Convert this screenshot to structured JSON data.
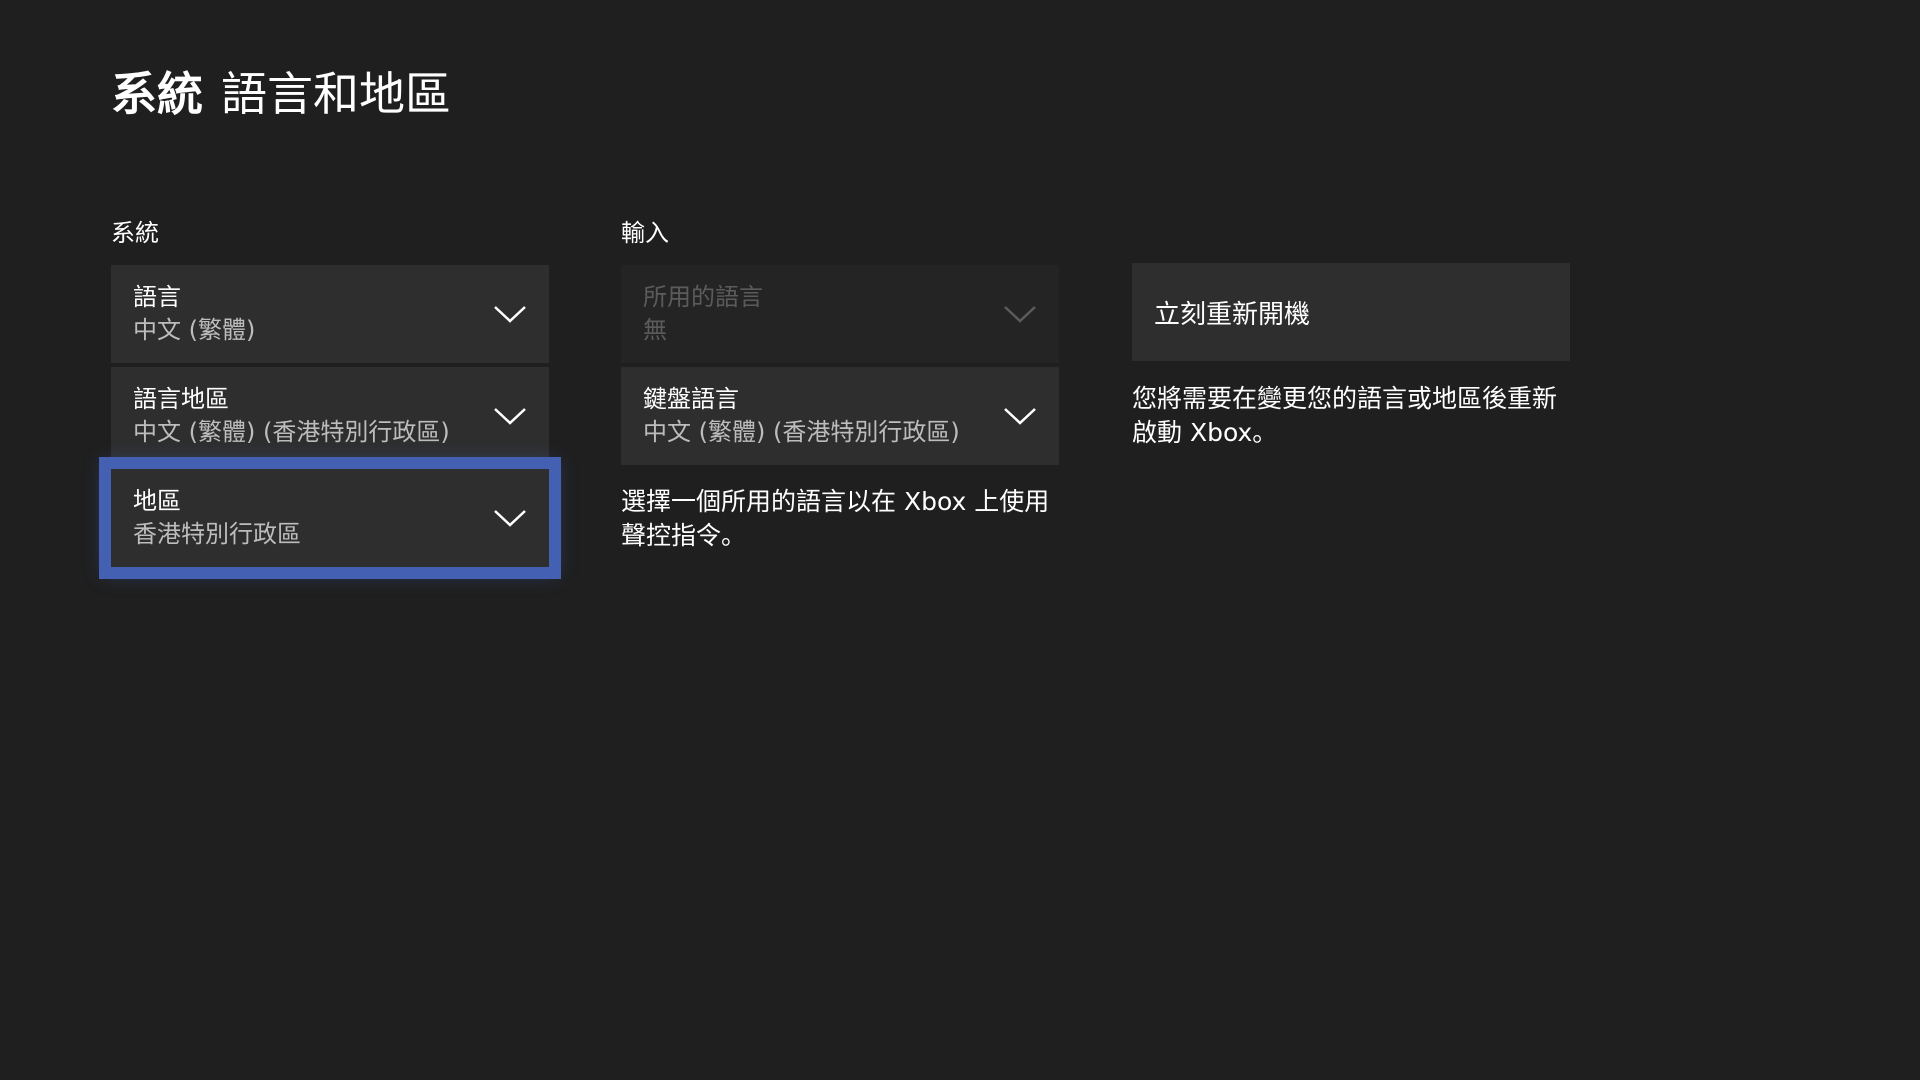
{
  "header": {
    "section": "系統",
    "page": "語言和地區"
  },
  "system_column": {
    "heading": "系統",
    "items": [
      {
        "label": "語言",
        "value": "中文 (繁體)"
      },
      {
        "label": "語言地區",
        "value": "中文 (繁體) (香港特別行政區)"
      },
      {
        "label": "地區",
        "value": "香港特別行政區"
      }
    ]
  },
  "input_column": {
    "heading": "輸入",
    "items": [
      {
        "label": "所用的語言",
        "value": "無"
      },
      {
        "label": "鍵盤語言",
        "value": "中文 (繁體) (香港特別行政區)"
      }
    ],
    "description": "選擇一個所用的語言以在 Xbox 上使用聲控指令。"
  },
  "restart": {
    "button_label": "立刻重新開機",
    "description": "您將需要在變更您的語言或地區後重新啟動 Xbox。"
  },
  "colors": {
    "background": "#1f1f1f",
    "tile": "#2e2e2e",
    "focus": "#4360b3"
  }
}
